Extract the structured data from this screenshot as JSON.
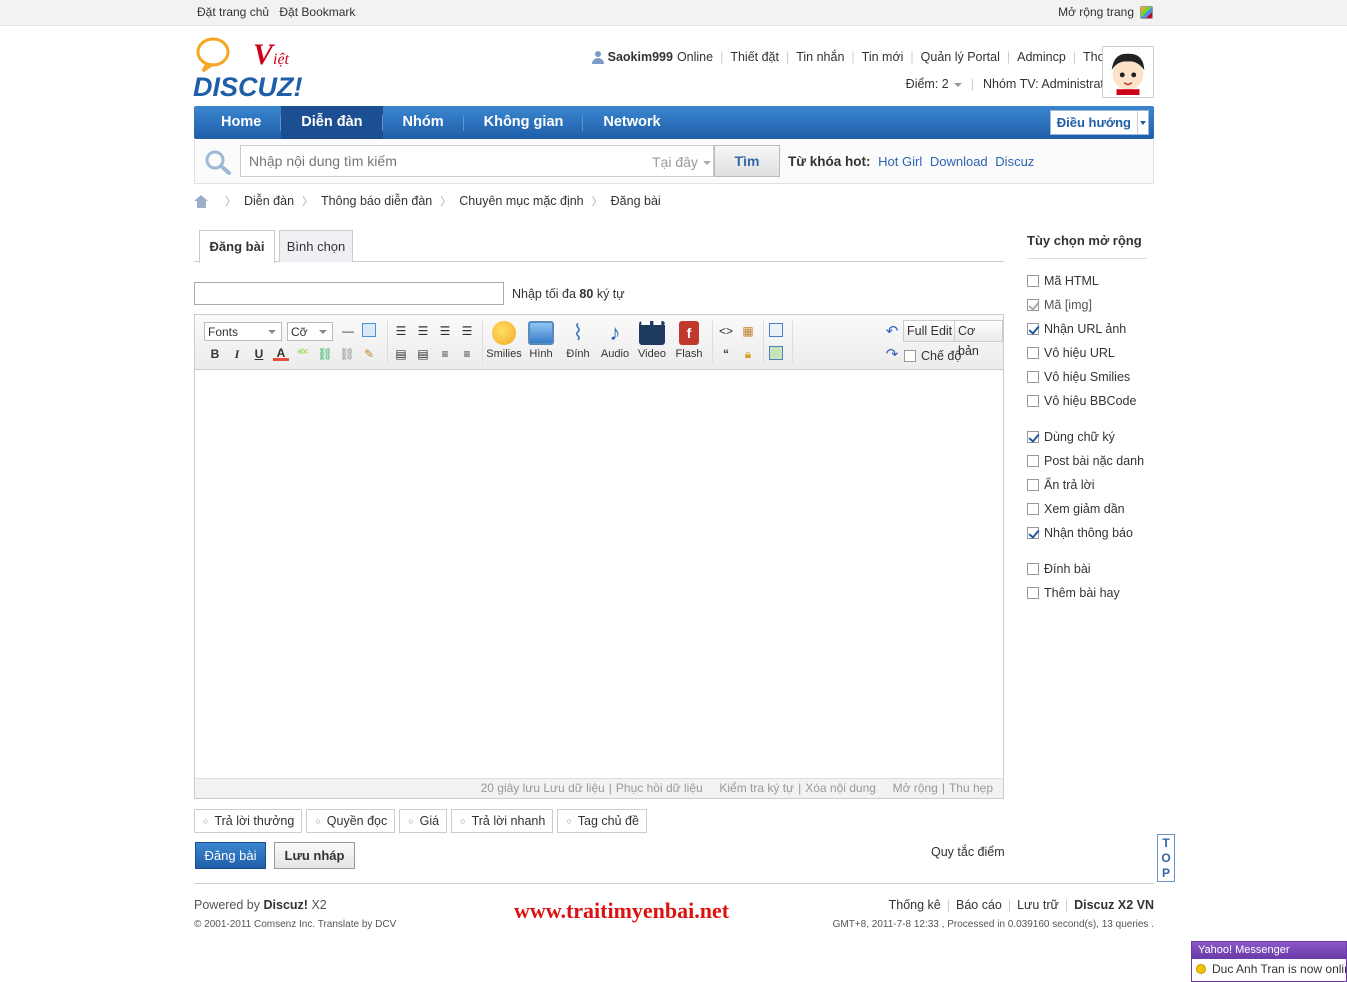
{
  "topbar": {
    "set_home": "Đặt trang chủ",
    "set_bookmark": "Đặt Bookmark",
    "expand": "Mở rộng trang"
  },
  "header": {
    "username": "Saokim999",
    "online": "Online",
    "links": [
      "Thiết đặt",
      "Tin nhắn",
      "Tin mới",
      "Quản lý Portal",
      "Admincp",
      "Thoát"
    ],
    "points_label": "Điểm: 2",
    "group_label": "Nhóm TV: Administrator"
  },
  "nav": {
    "items": [
      "Home",
      "Diễn đàn",
      "Nhóm",
      "Không gian",
      "Network"
    ],
    "active_index": 1,
    "nav_button": "Điều hướng"
  },
  "search": {
    "placeholder": "Nhập nội dung tìm kiếm",
    "scope": "Tại đây",
    "button": "Tìm",
    "hot_label": "Từ khóa hot:",
    "hot_words": [
      "Hot Girl",
      "Download",
      "Discuz"
    ]
  },
  "breadcrumb": [
    "Diễn đàn",
    "Thông báo diễn đàn",
    "Chuyên mục mặc định",
    "Đăng bài"
  ],
  "tabs": [
    "Đăng bài",
    "Bình chọn"
  ],
  "subject": {
    "value": "",
    "hint_prefix": "Nhập tối đa",
    "hint_num": "80",
    "hint_suffix": "ký tự"
  },
  "editor": {
    "font_select": "Fonts",
    "size_select": "Cỡ",
    "format_buttons": [
      "B",
      "I",
      "U",
      "A"
    ],
    "media_buttons": [
      "Smilies",
      "Hình",
      "Đính",
      "Audio",
      "Video",
      "Flash"
    ],
    "full_edit": "Full Edit",
    "basic": "Cơ bản",
    "mode_label": "Chế độ",
    "status": [
      "20 giây lưu",
      "Lưu dữ liệu",
      "Phục hồi dữ liệu",
      "Kiểm tra ký tự",
      "Xóa nội dung",
      "Mở rộng",
      "Thu hẹp"
    ]
  },
  "extra_tabs": [
    "Trả lời thưởng",
    "Quyền đọc",
    "Giá",
    "Trả lời nhanh",
    "Tag chủ đề"
  ],
  "actions": {
    "post": "Đăng bài",
    "draft": "Lưu nháp",
    "rules": "Quy tắc điểm"
  },
  "top_button": [
    "T",
    "O",
    "P"
  ],
  "sidebar": {
    "title": "Tùy chọn mở rộng",
    "groups": [
      [
        {
          "label": "Mã HTML",
          "checked": false,
          "disabled": false
        },
        {
          "label": "Mã [img]",
          "checked": true,
          "disabled": true
        },
        {
          "label": "Nhận URL ảnh",
          "checked": true,
          "disabled": false
        },
        {
          "label": "Vô hiệu URL",
          "checked": false,
          "disabled": false
        },
        {
          "label": "Vô hiệu Smilies",
          "checked": false,
          "disabled": false
        },
        {
          "label": "Vô hiệu BBCode",
          "checked": false,
          "disabled": false
        }
      ],
      [
        {
          "label": "Dùng chữ ký",
          "checked": true,
          "disabled": false
        },
        {
          "label": "Post bài nặc danh",
          "checked": false,
          "disabled": false
        },
        {
          "label": "Ẩn trả lời",
          "checked": false,
          "disabled": false
        },
        {
          "label": "Xem giảm dần",
          "checked": false,
          "disabled": false
        },
        {
          "label": "Nhận thông báo",
          "checked": true,
          "disabled": false
        }
      ],
      [
        {
          "label": "Đính bài",
          "checked": false,
          "disabled": false
        },
        {
          "label": "Thêm bài hay",
          "checked": false,
          "disabled": false
        }
      ]
    ]
  },
  "footer": {
    "powered_prefix": "Powered by",
    "powered_name": "Discuz!",
    "powered_ver": "X2",
    "copyright": "© 2001-2011 Comsenz Inc. Translate by DCV",
    "watermark": "www.traitimyenbai.net",
    "links": [
      "Thống kê",
      "Báo cáo",
      "Lưu trữ"
    ],
    "brand": "Discuz X2 VN",
    "gmt": "GMT+8, 2011-7-8 12:33 , Processed in 0.039160 second(s), 13 queries ."
  },
  "yahoo": {
    "title": "Yahoo! Messenger",
    "message": "Duc Anh Tran is now online"
  },
  "colors": {
    "nav": "#1f5ea8",
    "accent": "#2d64b3",
    "watermark": "#dd1111"
  }
}
